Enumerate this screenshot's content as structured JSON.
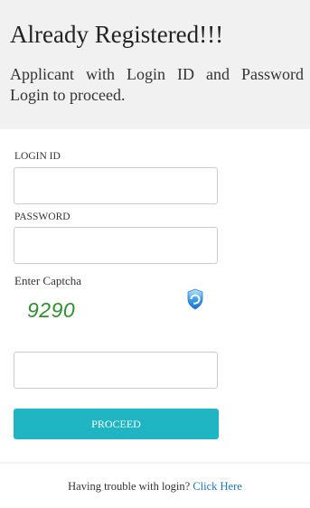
{
  "header": {
    "title": "Already Registered!!!",
    "description": "Applicant with Login ID and Password Login to proceed."
  },
  "form": {
    "login_id_label": "LOGIN ID",
    "login_id_value": "",
    "password_label": "PASSWORD",
    "password_value": "",
    "captcha_label": "Enter Captcha",
    "captcha_text": "9290",
    "captcha_value": "",
    "refresh_icon": "refresh-icon",
    "proceed_label": "PROCEED"
  },
  "footer": {
    "trouble_text": "Having trouble with login? ",
    "link_label": "Click Here"
  },
  "colors": {
    "header_bg": "#f1f1f1",
    "button_bg": "#1fb5c2",
    "captcha_color": "#2f8f2f",
    "link_color": "#1a73c9"
  }
}
